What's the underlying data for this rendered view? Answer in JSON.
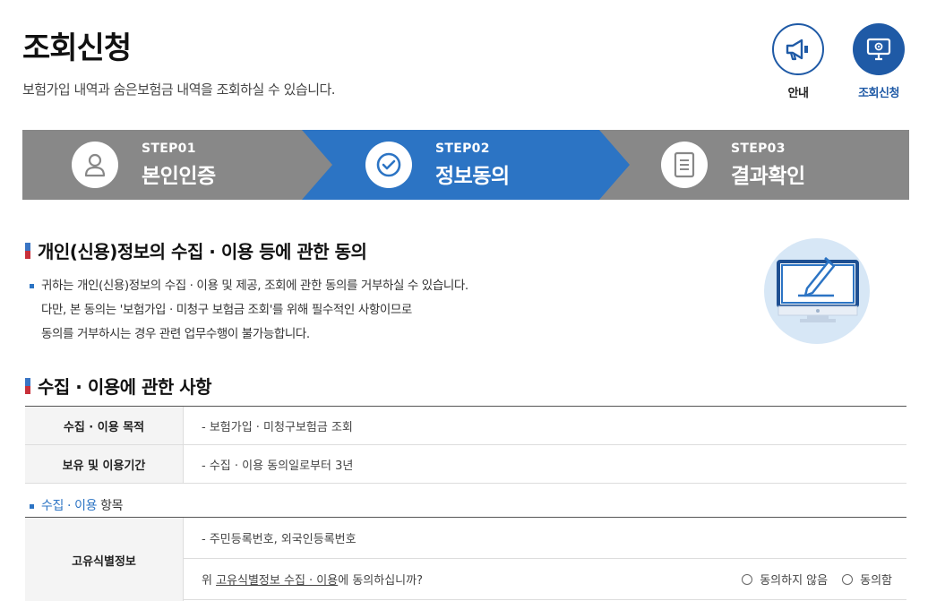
{
  "header": {
    "title": "조회신청",
    "description": "보험가입 내역과 숨은보험금 내역을 조회하실 수 있습니다."
  },
  "top_buttons": {
    "guide": {
      "label": "안내",
      "icon": "megaphone-icon"
    },
    "inquiry": {
      "label": "조회신청",
      "icon": "monitor-icon"
    }
  },
  "steps": [
    {
      "num": "STEP01",
      "name": "본인인증",
      "icon": "person-icon",
      "active": false
    },
    {
      "num": "STEP02",
      "name": "정보동의",
      "icon": "check-circle-icon",
      "active": true
    },
    {
      "num": "STEP03",
      "name": "결과확인",
      "icon": "document-icon",
      "active": false
    }
  ],
  "colors": {
    "accent": "#2c74c4",
    "brand": "#1f5aa6",
    "step_inactive": "#888888",
    "title_bar_top": "#3a75c4",
    "title_bar_bottom": "#c8303a"
  },
  "section1": {
    "title": "개인(신용)정보의 수집 · 이용 등에 관한 동의",
    "lines": [
      "귀하는 개인(신용)정보의 수집 · 이용 및 제공, 조회에 관한 동의를 거부하실 수 있습니다.",
      "다만, 본 동의는 '보험가입 · 미청구 보험금 조회'를 위해 필수적인 사항이므로",
      "동의를 거부하시는 경우 관련 업무수행이 불가능합니다."
    ]
  },
  "section2": {
    "title": "수집 · 이용에 관한 사항",
    "rows": [
      {
        "th": "수집 · 이용 목적",
        "td": "- 보험가입 · 미청구보험금 조회"
      },
      {
        "th": "보유 및 이용기간",
        "td": "- 수집 · 이용 동의일로부터 3년"
      }
    ],
    "items_label_hl": "수집 · 이용",
    "items_label_rest": " 항목",
    "unique_id": {
      "th": "고유식별정보",
      "value": "- 주민등록번호, 외국인등록번호",
      "question_pre": "위 ",
      "question_link": "고유식별정보 수집 · 이용",
      "question_post": "에 동의하십니까?",
      "option_disagree": "동의하지 않음",
      "option_agree": "동의함"
    }
  }
}
